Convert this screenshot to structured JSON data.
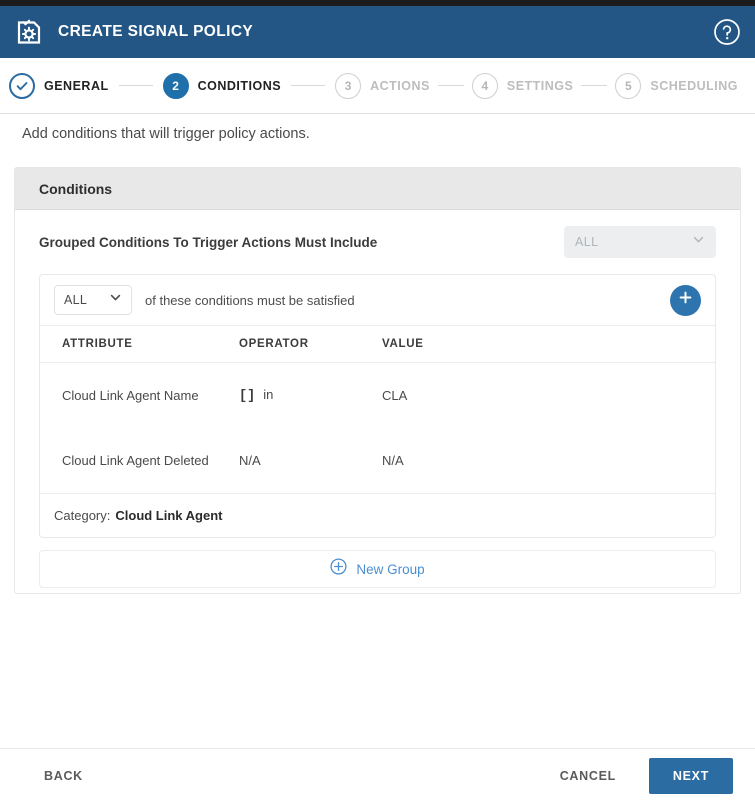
{
  "header": {
    "title": "CREATE SIGNAL POLICY",
    "brand_color": "#235685",
    "logo_icon": "policy-gear-document-icon",
    "help_icon": "help-circle-icon"
  },
  "stepper": {
    "steps": [
      {
        "number": "1",
        "label": "GENERAL",
        "state": "done",
        "marker": "check-icon"
      },
      {
        "number": "2",
        "label": "CONDITIONS",
        "state": "current",
        "marker": "2"
      },
      {
        "number": "3",
        "label": "ACTIONS",
        "state": "todo",
        "marker": "3"
      },
      {
        "number": "4",
        "label": "SETTINGS",
        "state": "todo",
        "marker": "4"
      },
      {
        "number": "5",
        "label": "SCHEDULING",
        "state": "todo",
        "marker": "5"
      }
    ],
    "active_color": "#1f6fab",
    "inactive_color": "#bdbdbd"
  },
  "instruction": "Add conditions that will trigger policy actions.",
  "conditions_card": {
    "title": "Conditions",
    "grouped": {
      "label": "Grouped Conditions To Trigger Actions Must Include",
      "select_value": "ALL",
      "select_disabled": true,
      "caret_icon": "chevron-down-icon"
    },
    "group": {
      "match_select_value": "ALL",
      "match_text": "of these conditions must be satisfied",
      "add_button_icon": "plus-icon",
      "add_button_color": "#2e74ae",
      "table": {
        "columns": [
          "ATTRIBUTE",
          "OPERATOR",
          "VALUE"
        ],
        "rows": [
          {
            "attribute": "Cloud Link Agent Name",
            "operator_symbol": "[]",
            "operator": "in",
            "value": "CLA"
          },
          {
            "attribute": "Cloud Link Agent Deleted",
            "operator_symbol": "",
            "operator": "N/A",
            "value": "N/A"
          }
        ]
      },
      "category_label": "Category:",
      "category_value": "Cloud Link Agent"
    },
    "new_group": {
      "label": "New Group",
      "icon": "plus-circle-icon",
      "color": "#4b8fd0"
    }
  },
  "footer": {
    "back_label": "BACK",
    "cancel_label": "CANCEL",
    "next_label": "NEXT",
    "next_color": "#2b6ca3"
  }
}
